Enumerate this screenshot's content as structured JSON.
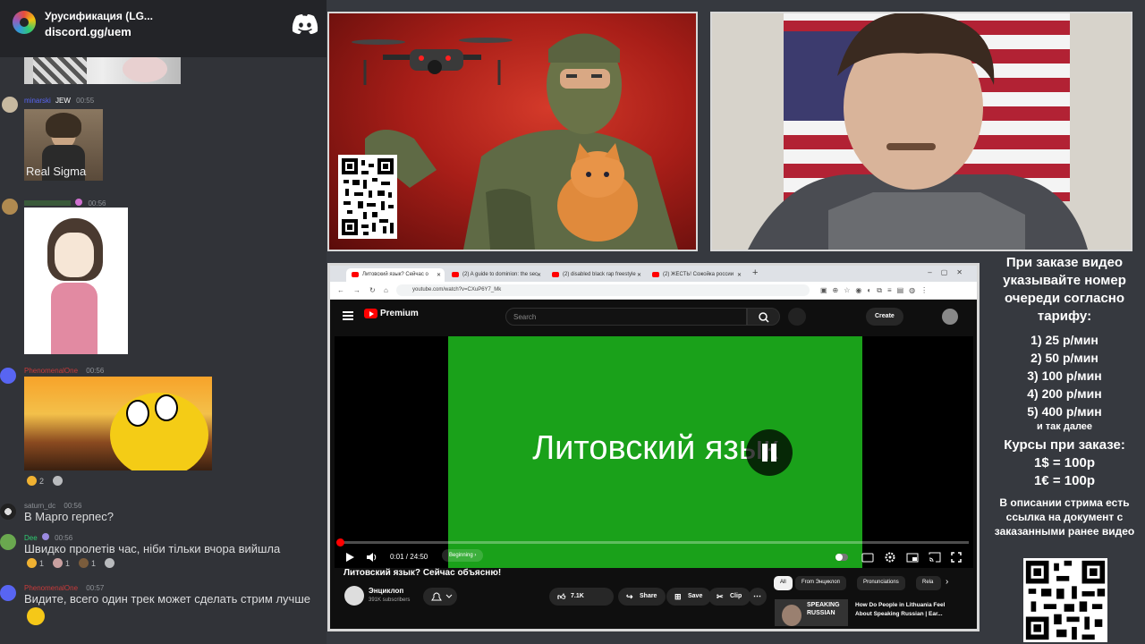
{
  "discord": {
    "server_name": "Урусификация (LG...",
    "server_link": "discord.gg/uem",
    "messages": [
      {
        "author": "minarski",
        "badge": "JEW",
        "time": "00:55",
        "image_caption": "Real Sigma"
      },
      {
        "author": "",
        "time": "00:56"
      },
      {
        "author": "PhenomenalOne",
        "time": "00:56",
        "reactions": [
          {
            "emoji": "pray",
            "count": "2"
          },
          {
            "emoji": "add-reaction",
            "count": ""
          }
        ]
      },
      {
        "author": "saturn_dc",
        "time": "00:56",
        "text": "В Марго герпес?"
      },
      {
        "author": "Dee",
        "time": "00:56",
        "text": "Швидко пролетів час, ніби тільки вчора вийшла",
        "reactions": [
          {
            "emoji": "cry",
            "count": "1"
          },
          {
            "emoji": "moai",
            "count": "1"
          },
          {
            "emoji": "dog",
            "count": "1"
          },
          {
            "emoji": "add-reaction",
            "count": ""
          }
        ]
      },
      {
        "author": "PhenomenalOne",
        "time": "00:57",
        "text": "Видите, всего один трек может сделать стрим лучше"
      }
    ]
  },
  "browser": {
    "tabs": [
      {
        "label": "Литовский язык? Сейчас о"
      },
      {
        "label": "(2) A guide to dominion: the sec"
      },
      {
        "label": "(2) disabled black rap freestyle"
      },
      {
        "label": "(2) ЖЕСТЬ! Сожойка россии"
      }
    ],
    "url": "youtube.com/watch?v=CXuP6Y7_Mk",
    "new_tab": "+"
  },
  "youtube": {
    "logo_text": "Premium",
    "search_placeholder": "Search",
    "create_label": "Create",
    "video_overlay_text": "Литовский язык",
    "progress": 0.0007,
    "time": "0:01 / 24:50",
    "chapter": "Beginning",
    "video_title": "Литовский язык? Сейчас объясню!",
    "channel_name": "Энциклоп",
    "channel_subs": "391K subscribers",
    "likes": "7.1K",
    "share_label": "Share",
    "save_label": "Save",
    "clip_label": "Clip",
    "chips": [
      "All",
      "From Энциклоп",
      "Pronunciations",
      "Rela"
    ],
    "rec_title": "How Do People in Lithuania Feel About Speaking Russian | Ear...",
    "rec_thumb_text": "SPEAKING RUSSIAN"
  },
  "info_panel": {
    "intro": "При заказе видео указывайте номер очереди согласно тарифу:",
    "prices": [
      "1) 25 р/мин",
      "2) 50 р/мин",
      "3) 100 р/мин",
      "4) 200 р/мин",
      "5) 400 р/мин"
    ],
    "etc": "и так далее",
    "courses_title": "Курсы при заказе:",
    "course_usd": "1$ = 100р",
    "course_eur": "1€ = 100р",
    "description": "В описании стрима есть ссылка на документ с заказанными ранее видео"
  },
  "colors": {
    "discord_blurple": "#5865f2",
    "youtube_red": "#ff0000",
    "video_green": "#1aa11a"
  }
}
